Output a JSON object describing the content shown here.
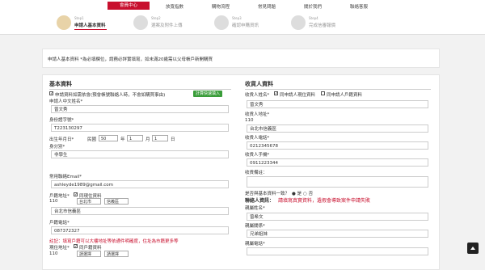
{
  "nav": {
    "items": [
      "會員中心",
      "放寬指數",
      "購物流程",
      "常見問題",
      "關於我們",
      "聯絡客服"
    ]
  },
  "steps": [
    {
      "num": "Step1",
      "title": "申請人基本資料"
    },
    {
      "num": "Step2",
      "title": "選案及附件上傳"
    },
    {
      "num": "Step3",
      "title": "確認申購資訊"
    },
    {
      "num": "Step4",
      "title": "完成信審報價"
    }
  ],
  "notice": "申請人基本資料 *為必填欄位，請務必詳實填寫，如未滿20歲需以父母帳戶新開購買",
  "left": {
    "heading": "基本資料",
    "auto_fill_label": "申請資料如需依會(預會帳號聯絡人時，不會如購買事由)",
    "auto_fill_button": "計算快速填入",
    "name_label": "申請人中文姓名*",
    "name_value": "曾文秀",
    "id_label": "身份證字號*",
    "id_value": "T223130297",
    "birth_label": "出生年月日*",
    "birth_era": "民國",
    "birth_year": "50",
    "birth_year_unit": "年",
    "birth_month": "1",
    "birth_month_unit": "月",
    "birth_day": "1",
    "birth_day_unit": "日",
    "identity_label": "身分別*",
    "identity_value": "非學生",
    "email_label": "常用聯絡Email*",
    "email_value": "ashleyde1989@gmail.com",
    "household_label": "戶籍地址*",
    "household_same": "同現住資料",
    "household_zip": "110",
    "household_city": "台北市",
    "household_district": "信義區",
    "household_street": "台北市信義區",
    "home_phone_label": "戶籍電話*",
    "home_phone_value": "087372327",
    "warning": "註記：填寫戶籍可以大樓地址等依通件明確度，住址為市籍更多等",
    "current_label": "現住地址*",
    "current_same": "同戶籍資料",
    "current_zip": "110",
    "current_city": "請選擇",
    "current_district": "請選擇"
  },
  "right": {
    "heading": "收貨人資料",
    "name_label": "收貨人姓名*",
    "same_current": "同申請人現住資料",
    "same_household": "同申請人戶籍資料",
    "name_value": "曾文秀",
    "address_label": "收貨人地址*",
    "zip": "110",
    "address_value": "台北市信義區",
    "phone_label": "收貨人電話*",
    "phone_value": "0212345678",
    "mobile_label": "收貨人手機*",
    "mobile_value": "0911223344",
    "remarks_label": "收貨備註：",
    "same_as_label": "是否與基本資料一致？",
    "same_yes": "是",
    "same_no": "否",
    "contact_heading": "聯絡人資訊：",
    "contact_warning": "請填寫真實資料，遺假會導致案件申請失敗",
    "contact_name_label": "親屬姓名*",
    "contact_name_value": "曾希文",
    "relation_label": "親屬關係*",
    "relation_value": "兄弟姐妹",
    "contact_phone_label": "親屬電話*"
  }
}
